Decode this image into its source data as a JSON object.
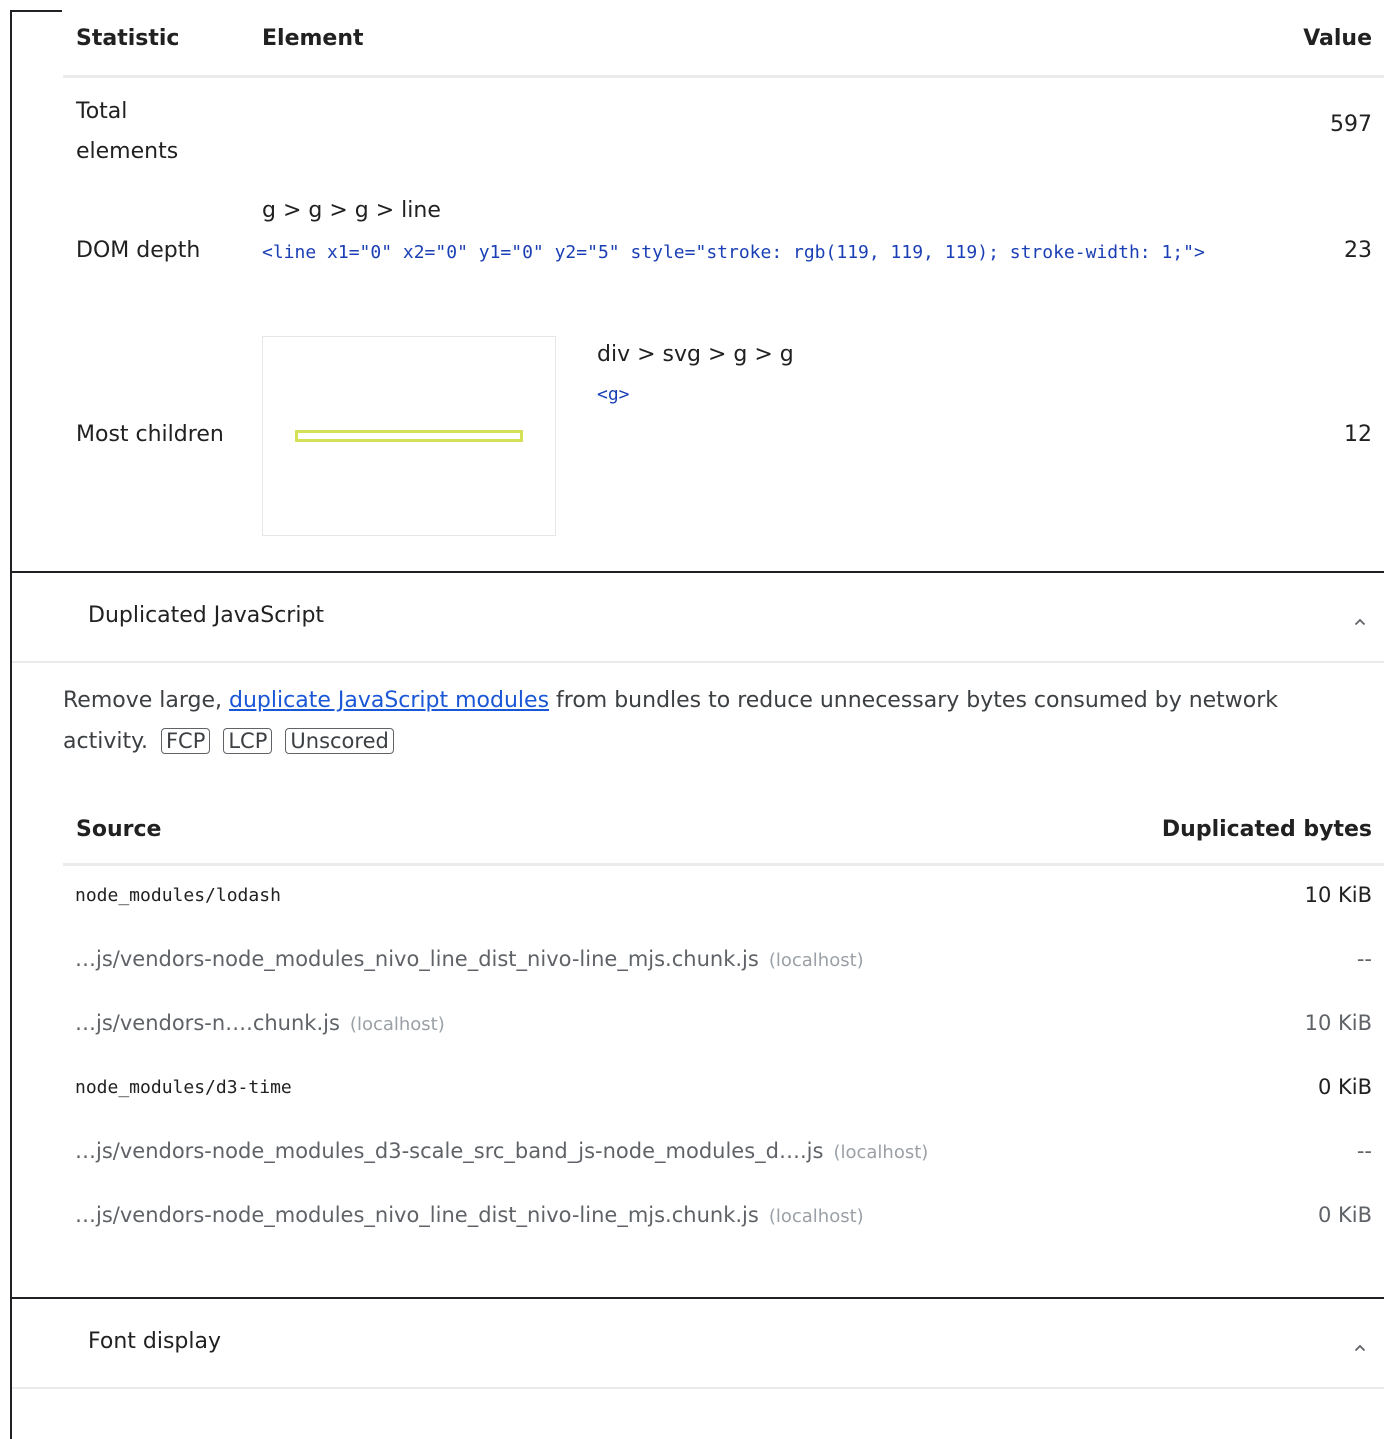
{
  "dom_table": {
    "headers": {
      "statistic": "Statistic",
      "element": "Element",
      "value": "Value"
    },
    "rows": [
      {
        "statistic": "Total elements",
        "value": "597"
      },
      {
        "statistic": "DOM depth",
        "path": "g > g > g > line",
        "snippet": "<line x1=\"0\" x2=\"0\" y1=\"0\" y2=\"5\" style=\"stroke: rgb(119, 119, 119); stroke-width: 1;\">",
        "value": "23"
      },
      {
        "statistic": "Most children",
        "path": "div > svg > g > g",
        "snippet": "<g>",
        "value": "12"
      }
    ]
  },
  "duplicated_js": {
    "title": "Duplicated JavaScript",
    "description_before": "Remove large, ",
    "description_link": "duplicate JavaScript modules",
    "description_after": " from bundles to reduce unnecessary bytes consumed by network activity.",
    "badges": [
      "FCP",
      "LCP",
      "Unscored"
    ],
    "headers": {
      "source": "Source",
      "bytes": "Duplicated bytes"
    },
    "rows": [
      {
        "source": "node_modules/lodash",
        "host": "",
        "value": "10 KiB",
        "group": true
      },
      {
        "source": "…js/vendors-node_modules_nivo_line_dist_nivo-line_mjs.chunk.js",
        "host": "(localhost)",
        "value": "--",
        "group": false
      },
      {
        "source": "…js/vendors-n….chunk.js",
        "host": "(localhost)",
        "value": "10 KiB",
        "group": false
      },
      {
        "source": "node_modules/d3-time",
        "host": "",
        "value": "0 KiB",
        "group": true
      },
      {
        "source": "…js/vendors-node_modules_d3-scale_src_band_js-node_modules_d….js",
        "host": "(localhost)",
        "value": "--",
        "group": false
      },
      {
        "source": "…js/vendors-node_modules_nivo_line_dist_nivo-line_mjs.chunk.js",
        "host": "(localhost)",
        "value": "0 KiB",
        "group": false
      }
    ]
  },
  "font_display": {
    "title": "Font display"
  },
  "icons": {
    "chevron": "chevron-up-icon"
  },
  "colors": {
    "thumbnail_bar": "#d4e157",
    "link": "#1a57d6",
    "code": "#1a3fb5"
  }
}
